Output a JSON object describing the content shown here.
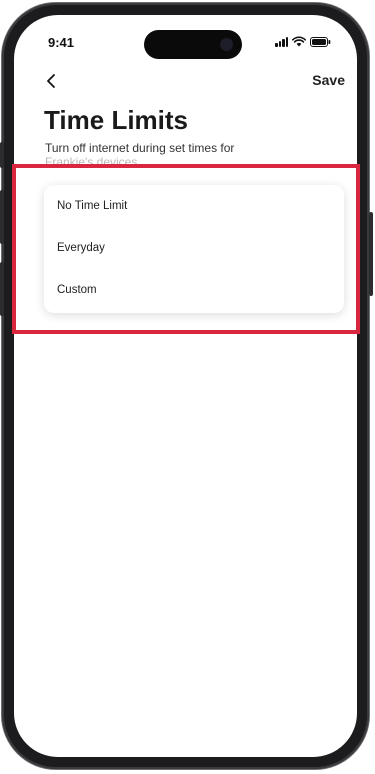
{
  "status_bar": {
    "time": "9:41"
  },
  "nav": {
    "back_icon": "chevron-left-icon",
    "save_label": "Save"
  },
  "page": {
    "title": "Time Limits",
    "subtitle_visible": "Turn off internet during set times for",
    "subtitle_faded": "Frankie's devices"
  },
  "options": [
    {
      "label": "No Time Limit"
    },
    {
      "label": "Everyday"
    },
    {
      "label": "Custom"
    }
  ],
  "colors": {
    "highlight": "#d7263d",
    "frame": "#1c1c1e",
    "text_primary": "#1a1a1a"
  }
}
